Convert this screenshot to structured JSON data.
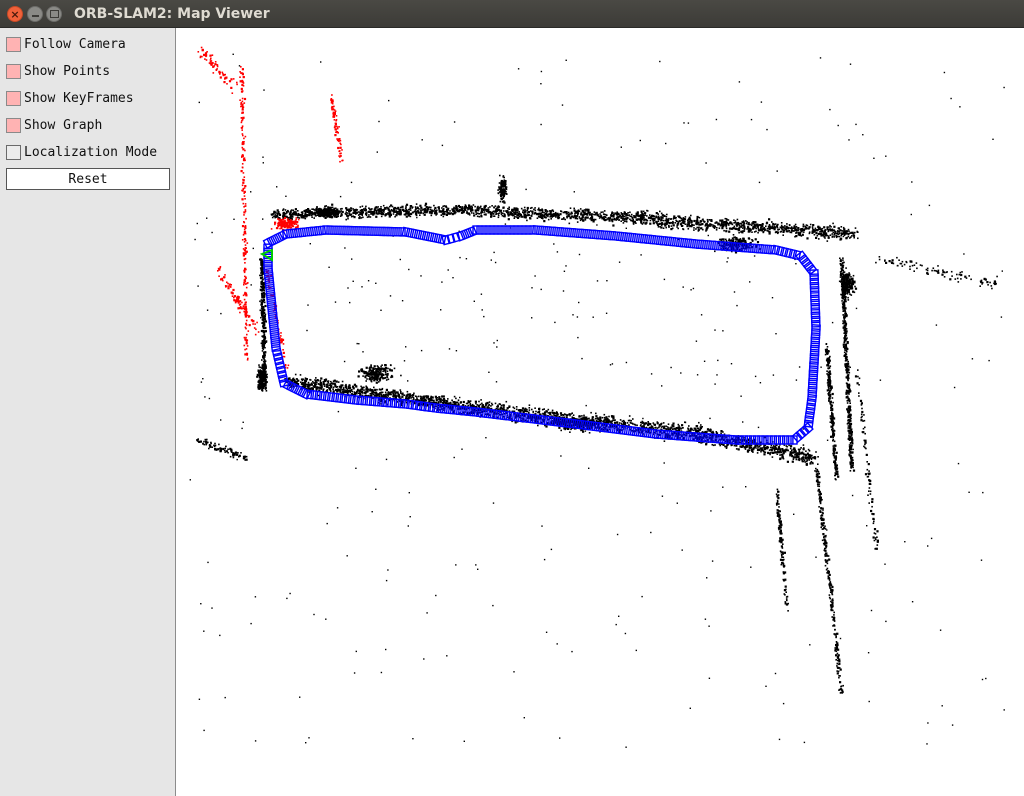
{
  "window": {
    "title": "ORB-SLAM2: Map Viewer"
  },
  "panel": {
    "options": [
      {
        "label": "Follow Camera",
        "checked": true
      },
      {
        "label": "Show Points",
        "checked": true
      },
      {
        "label": "Show KeyFrames",
        "checked": true
      },
      {
        "label": "Show Graph",
        "checked": true
      },
      {
        "label": "Localization Mode",
        "checked": false
      }
    ],
    "reset_label": "Reset"
  },
  "map": {
    "colors": {
      "map_points": "#000000",
      "current_points": "#ff0000",
      "keyframes": "#0000ff",
      "current_camera": "#00cc00",
      "checkbox_on": "#ffb3b3",
      "checkbox_off": "#ececec"
    }
  }
}
